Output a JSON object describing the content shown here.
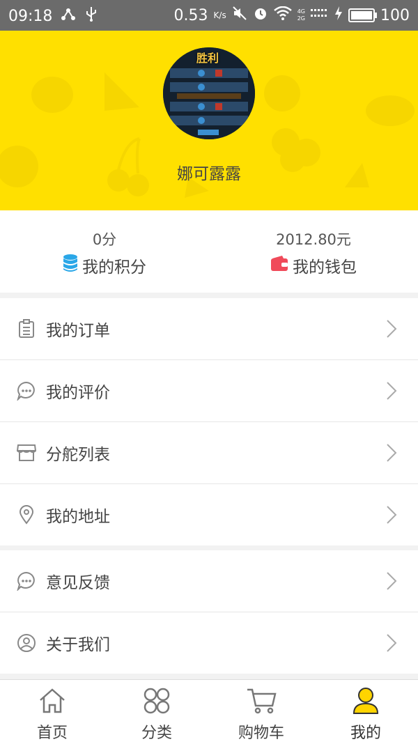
{
  "status_bar": {
    "time": "09:18",
    "net_speed": "0.53",
    "net_unit": "K/s",
    "battery": "100",
    "battery_level": 1.0,
    "net_types": [
      "4G",
      "2G"
    ]
  },
  "profile": {
    "username": "娜可露露",
    "avatar_caption": "胜利"
  },
  "stats": [
    {
      "value": "0分",
      "label": "我的积分",
      "icon": "database-icon",
      "color": "#2aa7e8"
    },
    {
      "value": "2012.80元",
      "label": "我的钱包",
      "icon": "wallet-icon",
      "color": "#f04a5a"
    }
  ],
  "menu_groups": [
    [
      {
        "label": "我的订单",
        "icon": "clipboard-icon"
      },
      {
        "label": "我的评价",
        "icon": "chat-bubble-icon"
      },
      {
        "label": "分舵列表",
        "icon": "store-icon"
      },
      {
        "label": "我的地址",
        "icon": "location-pin-icon"
      }
    ],
    [
      {
        "label": "意见反馈",
        "icon": "chat-bubble-icon"
      },
      {
        "label": "关于我们",
        "icon": "user-circle-icon"
      }
    ]
  ],
  "tabs": [
    {
      "label": "首页",
      "icon": "home-icon",
      "active": false
    },
    {
      "label": "分类",
      "icon": "grid-icon",
      "active": false
    },
    {
      "label": "购物车",
      "icon": "cart-icon",
      "active": false
    },
    {
      "label": "我的",
      "icon": "person-icon",
      "active": true
    }
  ],
  "colors": {
    "header_bg": "#ffe000",
    "active_tab_icon": "#ffd400",
    "status_bar": "#6b6b6b"
  }
}
